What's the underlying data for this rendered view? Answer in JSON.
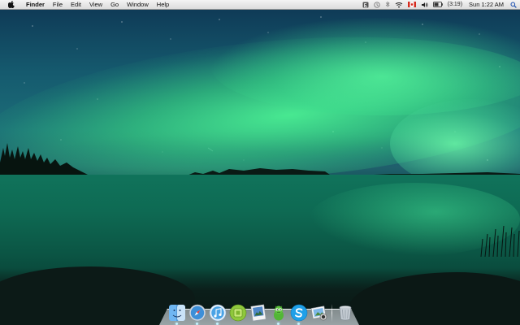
{
  "menubar": {
    "app_name": "Finder",
    "menus": [
      "File",
      "Edit",
      "View",
      "Go",
      "Window",
      "Help"
    ],
    "status_icons": [
      "evernote-icon",
      "time-machine-icon",
      "bluetooth-icon",
      "wifi-icon",
      "canada-flag-input-icon",
      "volume-icon",
      "battery-icon"
    ],
    "battery_text": "(3:19)",
    "clock": "Sun 1:22 AM"
  },
  "desktop": {
    "wallpaper": "aurora-over-lake"
  },
  "dock": {
    "apps": [
      {
        "name": "finder-icon",
        "running": true
      },
      {
        "name": "safari-icon",
        "running": true
      },
      {
        "name": "itunes-icon",
        "running": true
      },
      {
        "name": "green-app-icon",
        "running": false
      },
      {
        "name": "preview-icon",
        "running": false
      },
      {
        "name": "adium-icon",
        "running": true
      },
      {
        "name": "skype-icon",
        "running": true
      },
      {
        "name": "iphoto-icon",
        "running": false
      }
    ],
    "trash": "trash-icon"
  },
  "colors": {
    "aurora": "#50ff96",
    "lake": "#0e6a53",
    "menubar": "#e6e6e6"
  }
}
